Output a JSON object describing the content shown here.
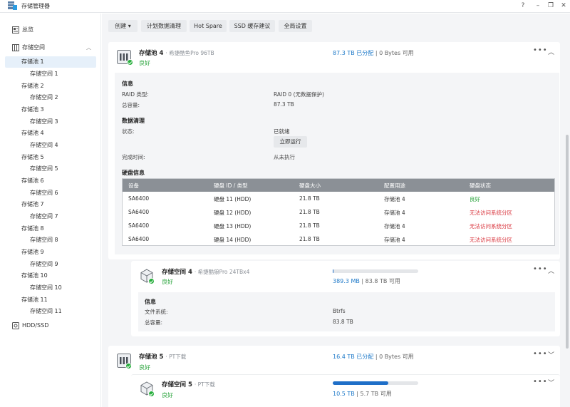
{
  "window": {
    "title": "存储管理器",
    "help": "?",
    "minimize": "–",
    "restore": "❐",
    "close": "✕"
  },
  "sidebar": {
    "overview": "总览",
    "storage_space": "存储空间",
    "hdd_ssd": "HDD/SSD",
    "items": [
      {
        "label": "存储池 1",
        "selected": true
      },
      {
        "label": "存储空间 1"
      },
      {
        "label": "存储池 2"
      },
      {
        "label": "存储空间 2"
      },
      {
        "label": "存储池 3"
      },
      {
        "label": "存储空间 3"
      },
      {
        "label": "存储池 4"
      },
      {
        "label": "存储空间 4"
      },
      {
        "label": "存储池 5"
      },
      {
        "label": "存储空间 5"
      },
      {
        "label": "存储池 6"
      },
      {
        "label": "存储空间 6"
      },
      {
        "label": "存储池 7"
      },
      {
        "label": "存储空间 7"
      },
      {
        "label": "存储池 8"
      },
      {
        "label": "存储空间 8"
      },
      {
        "label": "存储池 9"
      },
      {
        "label": "存储空间 9"
      },
      {
        "label": "存储池 10"
      },
      {
        "label": "存储空间 10"
      },
      {
        "label": "存储池 11"
      },
      {
        "label": "存储空间 11"
      }
    ]
  },
  "toolbar": {
    "create": "创建 ▾",
    "scrub_schedule": "计划数据清理",
    "hot_spare": "Hot Spare",
    "ssd_cache": "SSD 缓存建议",
    "global_settings": "全局设置"
  },
  "pool4": {
    "name": "存储池 4",
    "desc": "· 希捷酷鱼Pro 96TB",
    "status": "良好",
    "alloc_used": "87.3 TB 已分配",
    "alloc_rest": " | 0 Bytes 可用",
    "info_title": "信息",
    "raid_label": "RAID 类型:",
    "raid_value": "RAID 0 (无数据保护)",
    "cap_label": "总容量:",
    "cap_value": "87.3 TB",
    "scrub_title": "数据清理",
    "state_label": "状态:",
    "state_value": "已就绪",
    "run_now": "立即运行",
    "done_label": "完成时间:",
    "done_value": "从未执行",
    "disk_title": "硬盘信息",
    "table_headers": [
      "设备",
      "硬盘 ID / 类型",
      "硬盘大小",
      "配置用途",
      "硬盘状态"
    ],
    "disks": [
      {
        "device": "SA6400",
        "id": "硬盘 11 (HDD)",
        "size": "21.8 TB",
        "use": "存储池 4",
        "status": "良好",
        "ok": true
      },
      {
        "device": "SA6400",
        "id": "硬盘 12 (HDD)",
        "size": "21.8 TB",
        "use": "存储池 4",
        "status": "无法访问系统分区",
        "ok": false
      },
      {
        "device": "SA6400",
        "id": "硬盘 13 (HDD)",
        "size": "21.8 TB",
        "use": "存储池 4",
        "status": "无法访问系统分区",
        "ok": false
      },
      {
        "device": "SA6400",
        "id": "硬盘 14 (HDD)",
        "size": "21.8 TB",
        "use": "存储池 4",
        "status": "无法访问系统分区",
        "ok": false
      }
    ]
  },
  "vol4": {
    "name": "存储空间 4",
    "desc": "· 希捷酷狼Pro 24TBx4",
    "status": "良好",
    "used": "389.3 MB",
    "rest": " | 83.8 TB 可用",
    "usage_fraction": 0.0,
    "info_title": "信息",
    "fs_label": "文件系统:",
    "fs_value": "Btrfs",
    "cap_label": "总容量:",
    "cap_value": "83.8 TB"
  },
  "pool5": {
    "name": "存储池 5",
    "desc": "· PT下载",
    "status": "良好",
    "alloc_used": "16.4 TB 已分配",
    "alloc_rest": " | 0 Bytes 可用"
  },
  "vol5": {
    "name": "存储空间 5",
    "desc": "· PT下载",
    "status": "良好",
    "used": "10.5 TB",
    "rest": " | 5.7 TB 可用",
    "usage_fraction": 0.65
  },
  "colors": {
    "accent": "#1f6fc8",
    "ok": "#27a33a",
    "error": "#d9363e"
  },
  "icons": [
    "app-storage-icon",
    "overview-icon",
    "storage-space-icon",
    "hdd-icon",
    "pool-icon",
    "volume-icon",
    "ok-check-icon",
    "more-icon",
    "chevron-up-icon",
    "chevron-down-icon"
  ]
}
